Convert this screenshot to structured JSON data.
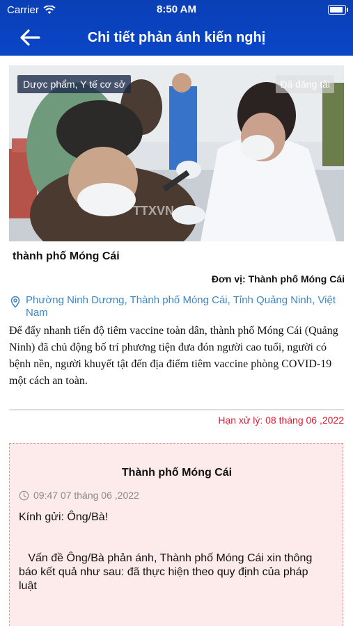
{
  "status_bar": {
    "carrier": "Carrier",
    "time": "8:50 AM",
    "battery_level": 0.9
  },
  "nav": {
    "title": "Chi tiết phản ánh kiến nghị"
  },
  "photo": {
    "category": "Dược phẩm, Y tế cơ sở",
    "status": "Đã đăng tải",
    "watermark": "TTXVN"
  },
  "report": {
    "location_title": "thành phố Móng Cái",
    "unit": "Đơn vị: Thành phố Móng Cái",
    "address": "Phường Ninh Dương, Thành phố Móng Cái, Tỉnh Quảng Ninh, Việt Nam",
    "description": "Để đẩy nhanh tiến độ tiêm vaccine toàn dân, thành phố Móng Cái (Quảng Ninh) đã chủ động bố trí phương tiện đưa đón người cao tuổi, người có bệnh nền, người khuyết tật đến địa điểm tiêm vaccine phòng COVID-19 một cách an toàn.",
    "deadline": "Hạn xử lý: 08 tháng 06 ,2022"
  },
  "response": {
    "title": "Thành phố Móng Cái",
    "time": "09:47 07 tháng 06 ,2022",
    "greeting": "Kính gửi: Ông/Bà!",
    "body": "   Vấn đề Ông/Bà phản ánh, Thành phố Móng Cái xin thông báo kết quả như sau: đã thực hiện theo quy định của pháp luật"
  },
  "colors": {
    "header": "#0b46c7",
    "link": "#3d86c6",
    "deadline": "#e0192f",
    "response_bg": "#fdeaea"
  },
  "icons": [
    "wifi-icon",
    "battery-icon",
    "back-arrow-icon",
    "location-pin-icon",
    "clock-icon"
  ]
}
